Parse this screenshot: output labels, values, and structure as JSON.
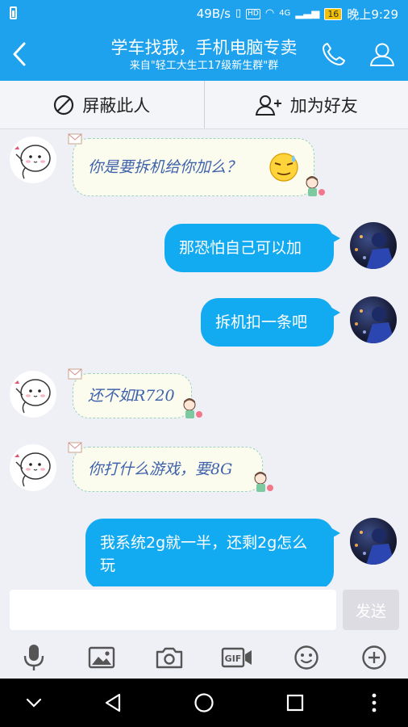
{
  "status_bar": {
    "speed": "49B/s",
    "network": "4G",
    "battery": "16",
    "time": "晚上9:29"
  },
  "header": {
    "title": "学车找我，手机电脑专卖",
    "subtitle": "来自\"轻工大生工17级新生群\"群"
  },
  "actions": {
    "block_label": "屏蔽此人",
    "add_friend_label": "加为好友"
  },
  "messages": [
    {
      "side": "left",
      "text": "你是要拆机给你加么？"
    },
    {
      "side": "right",
      "text": "那恐怕自己可以加"
    },
    {
      "side": "right",
      "text": "拆机扣一条吧"
    },
    {
      "side": "left",
      "text": "还不如R720"
    },
    {
      "side": "left",
      "text": "你打什么游戏，要8G"
    },
    {
      "side": "right",
      "text": "我系统2g就一半，还剩2g怎么玩"
    }
  ],
  "input": {
    "placeholder": "",
    "send_label": "发送"
  },
  "toolbar": {
    "items": [
      "microphone-icon",
      "image-icon",
      "camera-icon",
      "gif-icon",
      "emoji-icon",
      "plus-icon"
    ]
  },
  "colors": {
    "brand_blue": "#1ea2ee",
    "outgoing_bubble": "#12aaf0",
    "incoming_text": "#3f63ab",
    "background": "#efeff6"
  }
}
